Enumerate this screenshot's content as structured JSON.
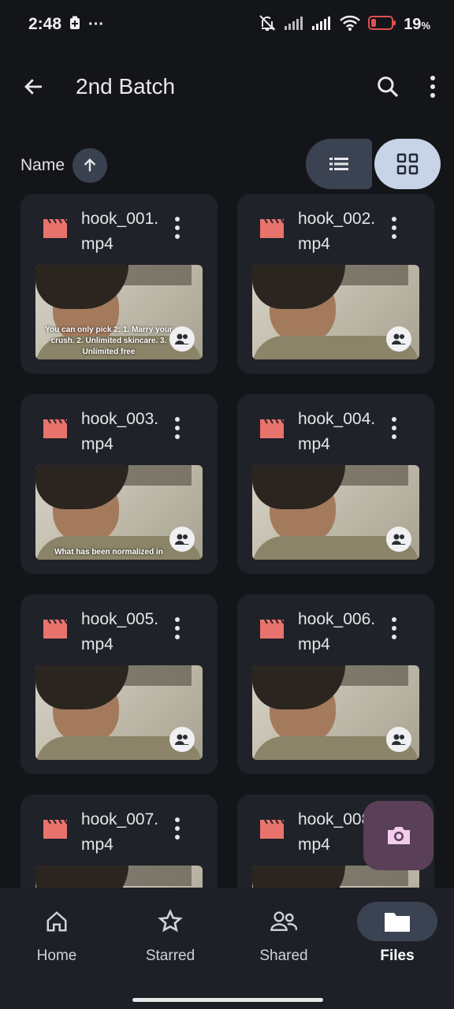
{
  "status_bar": {
    "time": "2:48",
    "more_notifications": "···",
    "battery_percent": "19"
  },
  "top_bar": {
    "title": "2nd Batch"
  },
  "sort": {
    "label": "Name"
  },
  "files": [
    {
      "name": "hook_001.mp4",
      "caption": "You can only pick 2: 1. Marry your crush. 2. Unlimited skincare. 3. Unlimited free"
    },
    {
      "name": "hook_002.mp4",
      "caption": ""
    },
    {
      "name": "hook_003.mp4",
      "caption": "What has been normalized in"
    },
    {
      "name": "hook_004.mp4",
      "caption": ""
    },
    {
      "name": "hook_005.mp4",
      "caption": ""
    },
    {
      "name": "hook_006.mp4",
      "caption": ""
    },
    {
      "name": "hook_007.mp4",
      "caption": ""
    },
    {
      "name": "hook_008.mp4",
      "caption": ""
    }
  ],
  "bottom_nav": [
    {
      "label": "Home",
      "icon": "home-icon",
      "active": false
    },
    {
      "label": "Starred",
      "icon": "star-icon",
      "active": false
    },
    {
      "label": "Shared",
      "icon": "shared-icon",
      "active": false
    },
    {
      "label": "Files",
      "icon": "folder-icon",
      "active": true
    }
  ],
  "colors": {
    "background": "#131519",
    "card": "#1f2228",
    "file_icon_red": "#e8736c",
    "toggle_active": "#c7d3e6",
    "camera_fab": "#5a3f58"
  }
}
